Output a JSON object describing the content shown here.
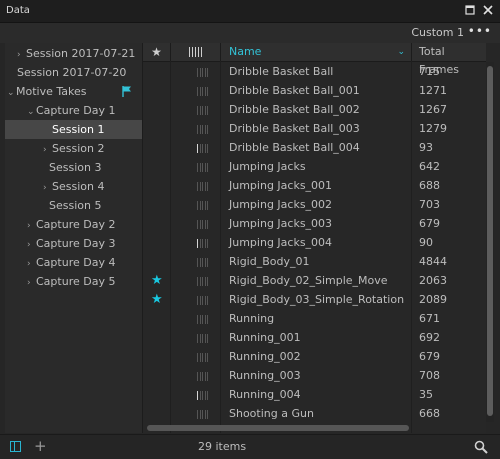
{
  "window": {
    "title": "Data"
  },
  "toolbar": {
    "preset": "Custom 1",
    "more": "•••"
  },
  "tree": [
    {
      "label": "Session 2017-07-21",
      "chevron": "›",
      "indent": 1
    },
    {
      "label": "Session 2017-07-20",
      "chevron": "",
      "indent": 1
    },
    {
      "label": "Motive Takes",
      "chevron": "⌄",
      "indent": 0,
      "flag": true
    },
    {
      "label": "Capture Day 1",
      "chevron": "⌄",
      "indent": 2
    },
    {
      "label": "Session 1",
      "chevron": "",
      "indent": 4,
      "selected": true
    },
    {
      "label": "Session 2",
      "chevron": "›",
      "indent": 3
    },
    {
      "label": "Session 3",
      "chevron": "",
      "indent": 4
    },
    {
      "label": "Session 4",
      "chevron": "›",
      "indent": 3
    },
    {
      "label": "Session 5",
      "chevron": "",
      "indent": 4
    },
    {
      "label": "Capture Day 2",
      "chevron": "›",
      "indent": 2
    },
    {
      "label": "Capture Day 3",
      "chevron": "›",
      "indent": 2
    },
    {
      "label": "Capture Day 4",
      "chevron": "›",
      "indent": 2
    },
    {
      "label": "Capture Day 5",
      "chevron": "›",
      "indent": 2
    }
  ],
  "columns": {
    "star": "★",
    "name": "Name",
    "frames": "Total Frames",
    "sort": "⌄"
  },
  "takes": [
    {
      "name": "Dribble Basket Ball",
      "frames": "715",
      "starred": false,
      "bar": 0
    },
    {
      "name": "Dribble Basket Ball_001",
      "frames": "1271",
      "starred": false,
      "bar": 0
    },
    {
      "name": "Dribble Basket Ball_002",
      "frames": "1267",
      "starred": false,
      "bar": 0
    },
    {
      "name": "Dribble Basket Ball_003",
      "frames": "1279",
      "starred": false,
      "bar": 0
    },
    {
      "name": "Dribble Basket Ball_004",
      "frames": "93",
      "starred": false,
      "bar": 1
    },
    {
      "name": "Jumping Jacks",
      "frames": "642",
      "starred": false,
      "bar": 0
    },
    {
      "name": "Jumping Jacks_001",
      "frames": "688",
      "starred": false,
      "bar": 0
    },
    {
      "name": "Jumping Jacks_002",
      "frames": "703",
      "starred": false,
      "bar": 0
    },
    {
      "name": "Jumping Jacks_003",
      "frames": "679",
      "starred": false,
      "bar": 0
    },
    {
      "name": "Jumping Jacks_004",
      "frames": "90",
      "starred": false,
      "bar": 1
    },
    {
      "name": "Rigid_Body_01",
      "frames": "4844",
      "starred": false,
      "bar": 0
    },
    {
      "name": "Rigid_Body_02_Simple_Move",
      "frames": "2063",
      "starred": true,
      "bar": 0
    },
    {
      "name": "Rigid_Body_03_Simple_Rotation",
      "frames": "2089",
      "starred": true,
      "bar": 0
    },
    {
      "name": "Running",
      "frames": "671",
      "starred": false,
      "bar": 0
    },
    {
      "name": "Running_001",
      "frames": "692",
      "starred": false,
      "bar": 0
    },
    {
      "name": "Running_002",
      "frames": "679",
      "starred": false,
      "bar": 0
    },
    {
      "name": "Running_003",
      "frames": "708",
      "starred": false,
      "bar": 0
    },
    {
      "name": "Running_004",
      "frames": "35",
      "starred": false,
      "bar": 1
    },
    {
      "name": "Shooting a Gun",
      "frames": "668",
      "starred": false,
      "bar": 0
    }
  ],
  "footer": {
    "count": "29 items"
  },
  "colors": {
    "accent": "#33c2d6",
    "star": "#19c8e0"
  },
  "icons": {
    "close": "close-icon",
    "maximize": "maximize-icon",
    "more": "more-icon",
    "flag": "flag-icon",
    "star": "star-icon",
    "bars": "bars-icon",
    "panel": "panel-toggle-icon",
    "add": "add-icon",
    "search": "search-icon"
  }
}
